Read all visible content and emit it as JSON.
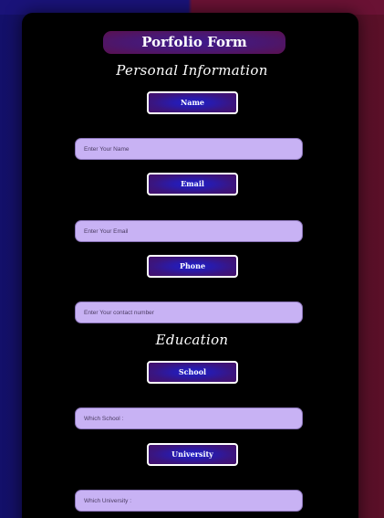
{
  "form": {
    "title": "Porfolio Form",
    "sections": {
      "personal": "Personal Information",
      "education": "Education"
    },
    "fields": {
      "name": {
        "label": "Name",
        "placeholder": "Enter Your Name",
        "value": ""
      },
      "email": {
        "label": "Email",
        "placeholder": "Enter Your Email",
        "value": ""
      },
      "phone": {
        "label": "Phone",
        "placeholder": "Enter Your contact number",
        "value": ""
      },
      "school": {
        "label": "School",
        "placeholder": "Which School :",
        "value": ""
      },
      "university": {
        "label": "University",
        "placeholder": "Which University :",
        "value": ""
      }
    }
  },
  "colors": {
    "card": "#000000",
    "input_bg": "#c8b2f4",
    "label_glow": "#1d1ed0",
    "title_bg": "#4a1770"
  }
}
